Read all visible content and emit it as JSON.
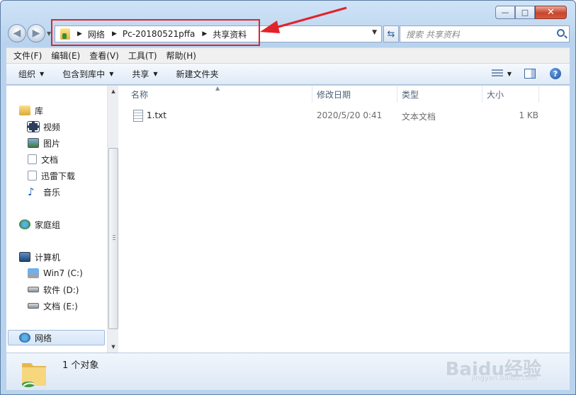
{
  "window": {
    "caption": {
      "minimize": "—",
      "maximize": "□",
      "close": "✕"
    }
  },
  "nav": {
    "breadcrumb": [
      "网络",
      "Pc-20180521pffa",
      "共享资料"
    ],
    "search_placeholder": "搜索 共享资料"
  },
  "menubar": [
    "文件(F)",
    "编辑(E)",
    "查看(V)",
    "工具(T)",
    "帮助(H)"
  ],
  "commandbar": {
    "organize": "组织",
    "include_in_library": "包含到库中",
    "share": "共享",
    "new_folder": "新建文件夹"
  },
  "navpane": {
    "libraries": "库",
    "library_items": [
      "视频",
      "图片",
      "文档",
      "迅雷下载",
      "音乐"
    ],
    "homegroup": "家庭组",
    "computer": "计算机",
    "drives": [
      "Win7 (C:)",
      "软件 (D:)",
      "文档 (E:)"
    ],
    "network": "网络"
  },
  "columns": {
    "name": "名称",
    "modified": "修改日期",
    "type": "类型",
    "size": "大小"
  },
  "files": [
    {
      "name": "1.txt",
      "modified": "2020/5/20 0:41",
      "type": "文本文档",
      "size": "1 KB"
    }
  ],
  "details": {
    "status": "1 个对象"
  },
  "watermark": {
    "brand": "Baidu经验",
    "url": "jingyan.baidu.com"
  },
  "colors": {
    "annotation": "#e0242a",
    "chrome": "#b9d3ee"
  }
}
